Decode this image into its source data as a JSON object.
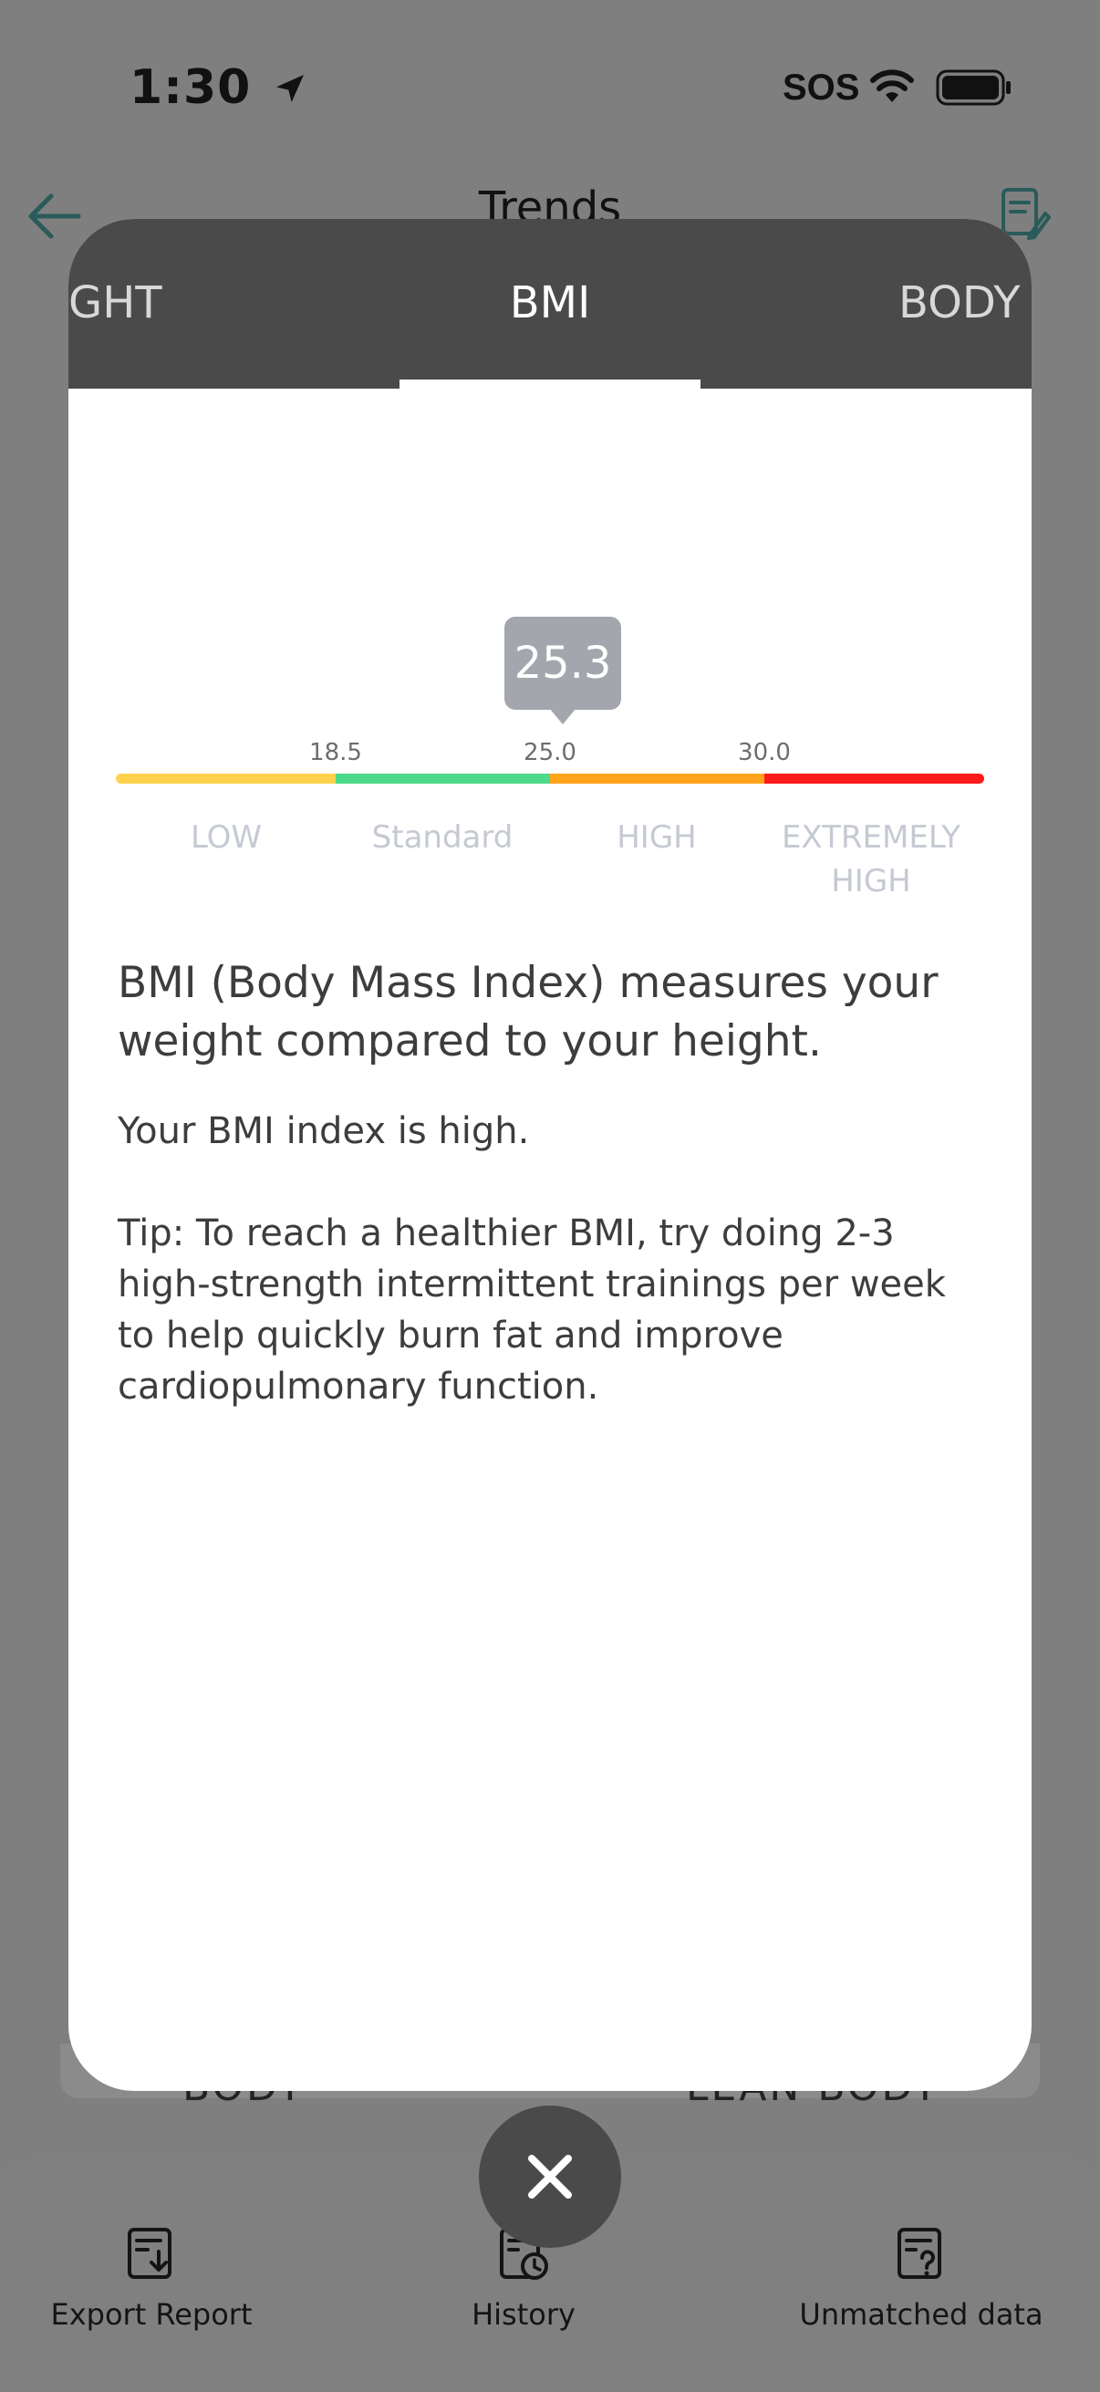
{
  "status_bar": {
    "time": "1:30",
    "sos": "SOS"
  },
  "page": {
    "title": "Trends",
    "partial_left": "BODY",
    "partial_right": "LEAN BODY"
  },
  "modal": {
    "tabs": [
      {
        "label": "GHT",
        "active": false
      },
      {
        "label": "BMI",
        "active": true
      },
      {
        "label": "BODY",
        "active": false
      }
    ],
    "value": "25.3",
    "thresholds": [
      "18.5",
      "25.0",
      "30.0"
    ],
    "ranges": [
      {
        "label": "LOW",
        "color": "#ffd24d"
      },
      {
        "label": "Standard",
        "color": "#4dd98a"
      },
      {
        "label": "HIGH",
        "color": "#ffa31a"
      },
      {
        "label": "EXTREMELY HIGH",
        "color": "#ff1a1a"
      }
    ],
    "heading": "BMI (Body Mass Index) measures your weight compared to your height.",
    "status_text": "Your BMI index is high.",
    "tip": "Tip: To reach a healthier BMI, try doing 2-3 high-strength intermittent trainings per week to help quickly burn fat and improve cardiopulmonary function."
  },
  "bottom_bar": {
    "items": [
      {
        "label": "Export Report",
        "icon": "export-report-icon"
      },
      {
        "label": "History",
        "icon": "history-icon"
      },
      {
        "label": "Unmatched data",
        "icon": "unmatched-data-icon"
      }
    ]
  },
  "icons": {
    "back": "back-arrow-icon",
    "edit": "edit-note-icon",
    "close": "close-icon",
    "location": "location-arrow-icon",
    "wifi": "wifi-icon",
    "battery": "battery-icon"
  }
}
